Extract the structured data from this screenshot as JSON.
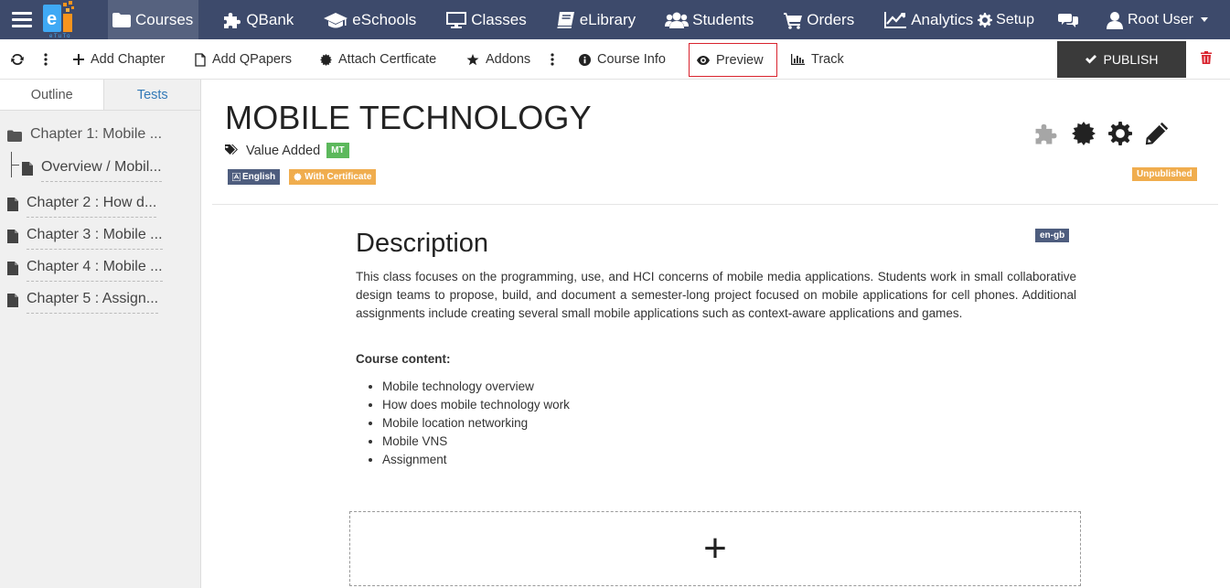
{
  "nav": {
    "items": [
      {
        "label": "Courses",
        "icon": "folder-icon"
      },
      {
        "label": "QBank",
        "icon": "puzzle-icon"
      },
      {
        "label": "eSchools",
        "icon": "graduation-cap-icon"
      },
      {
        "label": "Classes",
        "icon": "monitor-icon"
      },
      {
        "label": "eLibrary",
        "icon": "book-icon"
      },
      {
        "label": "Students",
        "icon": "users-icon"
      },
      {
        "label": "Orders",
        "icon": "cart-icon"
      },
      {
        "label": "Analytics",
        "icon": "line-chart-icon"
      }
    ],
    "setup_label": "Setup",
    "user_label": "Root User",
    "logo_text": "eTuTo"
  },
  "toolbar": {
    "add_chapter": "Add Chapter",
    "add_qpapers": "Add QPapers",
    "attach_certificate": "Attach Certficate",
    "addons": "Addons",
    "course_info": "Course Info",
    "preview": "Preview",
    "track": "Track",
    "publish": "PUBLISH"
  },
  "sidebar": {
    "tabs": [
      {
        "label": "Outline"
      },
      {
        "label": "Tests"
      }
    ],
    "items": [
      {
        "label": "Chapter 1: Mobile ..."
      },
      {
        "label": "Overview / Mobil..."
      },
      {
        "label": "Chapter 2 : How d..."
      },
      {
        "label": "Chapter 3 : Mobile ..."
      },
      {
        "label": "Chapter 4 : Mobile ..."
      },
      {
        "label": "Chapter 5 : Assign..."
      }
    ]
  },
  "course": {
    "title": "MOBILE TECHNOLOGY",
    "category": "Value Added",
    "code_badge": "MT",
    "language_badge": "English",
    "certificate_badge": "With Certificate",
    "status_badge": "Unpublished"
  },
  "description": {
    "heading": "Description",
    "locale_badge": "en-gb",
    "body": "This class focuses on the programming, use, and HCI concerns of mobile media applications. Students work in small collaborative design teams to propose, build, and document a semester-long project focused on mobile applications for cell phones. Additional assignments include creating several small mobile applications such as context-aware applications and games.",
    "content_label": "Course content:",
    "content_items": [
      "Mobile technology overview",
      "How does mobile technology work",
      "Mobile location networking",
      "Mobile VNS",
      "Assignment"
    ]
  },
  "add_block": {
    "symbol": "+"
  },
  "colors": {
    "nav_bg": "#3d4a6b",
    "badge_green": "#5cb85c",
    "badge_orange": "#f0ad4e",
    "badge_navy": "#4e5d7e",
    "preview_border": "#d9232e",
    "publish_bg": "#3a3a3a",
    "trash_red": "#d9232e"
  }
}
